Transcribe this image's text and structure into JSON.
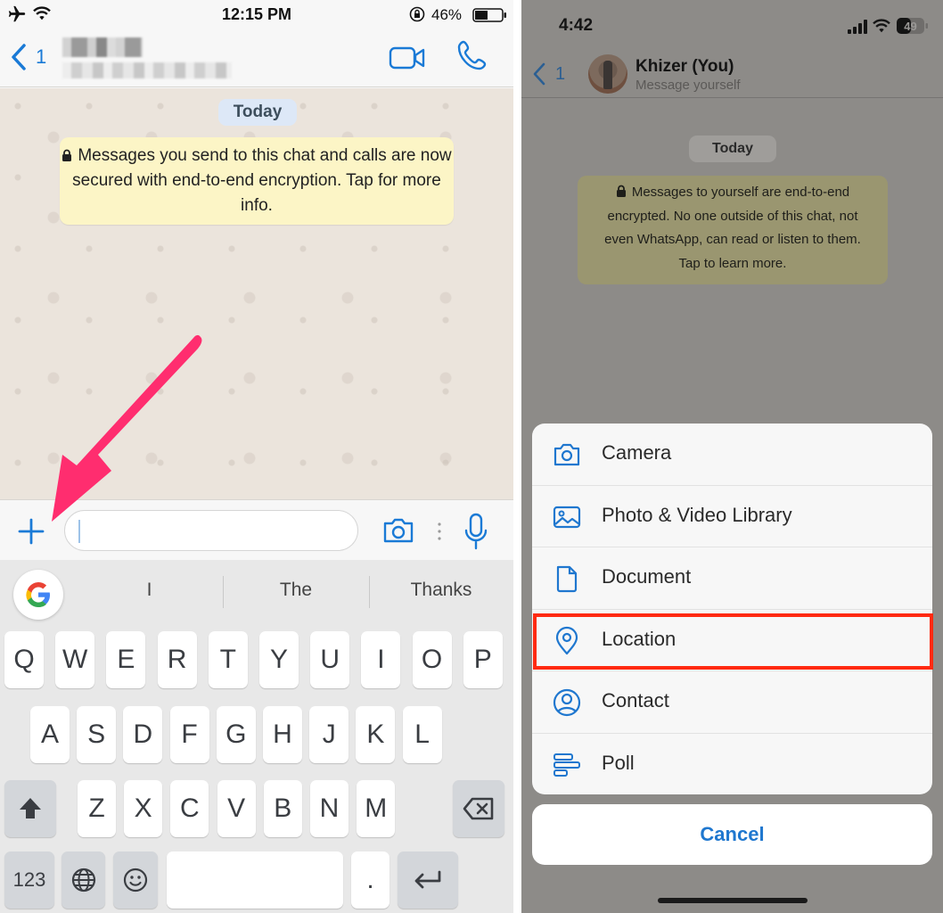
{
  "left_screen": {
    "status_bar": {
      "time": "12:15 PM",
      "battery_percent": "46%",
      "battery_level": 0.46,
      "airplane_mode": true,
      "wifi": true,
      "rotation_lock": true
    },
    "nav": {
      "back_count": "1",
      "contact_name": "(blurred)",
      "icons": [
        "video-call-icon",
        "voice-call-icon"
      ]
    },
    "chat": {
      "date_pill": "Today",
      "encryption_notice": "Messages you send to this chat and calls are now secured with end-to-end encryption. Tap for more info."
    },
    "annotation": {
      "type": "arrow",
      "color": "#ff2d6f",
      "points_to": "attach-plus-button"
    },
    "input_bar": {
      "value": "",
      "icons": [
        "plus-icon",
        "camera-icon",
        "more-dots-icon",
        "microphone-icon"
      ]
    },
    "keyboard": {
      "suggestions": [
        "I",
        "The",
        "Thanks"
      ],
      "rows": [
        [
          "Q",
          "W",
          "E",
          "R",
          "T",
          "Y",
          "U",
          "I",
          "O",
          "P"
        ],
        [
          "A",
          "S",
          "D",
          "F",
          "G",
          "H",
          "J",
          "K",
          "L"
        ],
        [
          "Z",
          "X",
          "C",
          "V",
          "B",
          "N",
          "M"
        ]
      ],
      "bottom_row": {
        "numbers_label": "123",
        "period_label": "."
      }
    }
  },
  "right_screen": {
    "status_bar": {
      "time": "4:42",
      "battery_percent": "49"
    },
    "nav": {
      "back_count": "1",
      "contact_name": "Khizer (You)",
      "subtitle": "Message yourself"
    },
    "chat": {
      "date_pill": "Today",
      "encryption_notice_lines": [
        "Messages to yourself are end-to-end",
        "encrypted. No one outside of this chat, not",
        "even WhatsApp, can read or listen to them.",
        "Tap to learn more."
      ]
    },
    "action_sheet": {
      "items": [
        {
          "label": "Camera",
          "icon": "camera-icon"
        },
        {
          "label": "Photo & Video Library",
          "icon": "photo-library-icon"
        },
        {
          "label": "Document",
          "icon": "document-icon"
        },
        {
          "label": "Location",
          "icon": "location-pin-icon",
          "highlighted": true
        },
        {
          "label": "Contact",
          "icon": "contact-icon"
        },
        {
          "label": "Poll",
          "icon": "poll-icon"
        }
      ],
      "cancel_label": "Cancel"
    },
    "colors": {
      "accent": "#1f77cf",
      "highlight_box": "#ff2a10"
    }
  }
}
